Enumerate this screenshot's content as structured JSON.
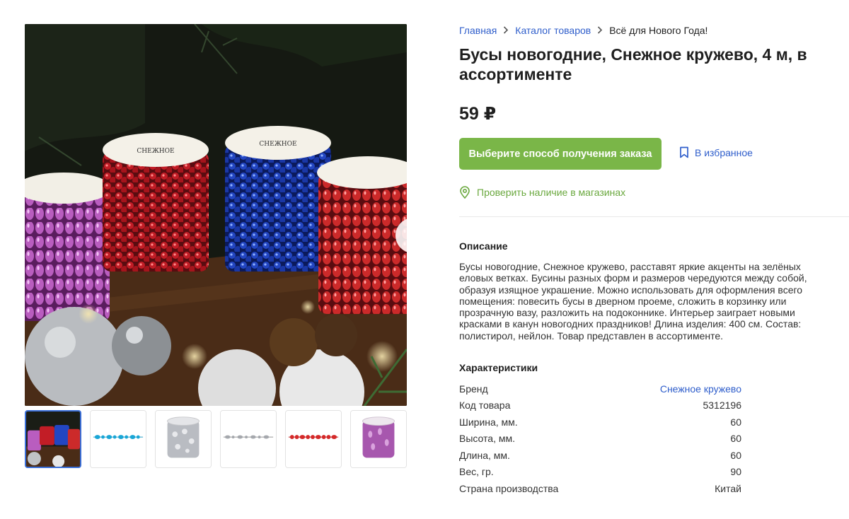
{
  "breadcrumb": {
    "home": "Главная",
    "catalog": "Каталог товаров",
    "current": "Всё для Нового Года!"
  },
  "product": {
    "title": "Бусы новогодние, Снежное кружево, 4 м, в ассортименте",
    "price": "59 ₽"
  },
  "actions": {
    "order_label": "Выберите способ получения заказа",
    "favorite_label": "В избранное",
    "check_stock_label": "Проверить наличие в магазинах"
  },
  "description": {
    "heading": "Описание",
    "text": "Бусы новогодние, Снежное кружево, расставят яркие акценты на зелёных еловых ветках. Бусины разных форм и размеров чередуются между собой, образуя изящное украшение. Можно использовать для оформления всего помещения: повесить бусы в дверном проеме, сложить в корзинку или прозрачную вазу, разложить на подоконнике. Интерьер заиграет новыми красками в канун новогодних праздников! Длина изделия: 400 см. Состав: полистирол, нейлон. Товар представлен в ассортименте."
  },
  "specs": {
    "heading": "Характеристики",
    "rows": [
      {
        "label": "Бренд",
        "value": "Снежное кружево"
      },
      {
        "label": "Код товара",
        "value": "5312196"
      },
      {
        "label": "Ширина, мм.",
        "value": "60"
      },
      {
        "label": "Высота, мм.",
        "value": "60"
      },
      {
        "label": "Длина, мм.",
        "value": "60"
      },
      {
        "label": "Вес, гр.",
        "value": "90"
      },
      {
        "label": "Страна производства",
        "value": "Китай"
      }
    ]
  },
  "gallery": {
    "thumb_variants": [
      "jars-photo",
      "blue-beads",
      "silver-jar",
      "silver-beads",
      "red-beads",
      "purple-jar"
    ],
    "active_index": 0
  },
  "icons": {
    "next": "arrow-right-icon",
    "favorite": "bookmark-icon",
    "location": "location-pin-icon"
  },
  "colors": {
    "link": "#2f5ecb",
    "accent_green": "#7ab648",
    "active_thumb_border": "#3a6fd8"
  }
}
